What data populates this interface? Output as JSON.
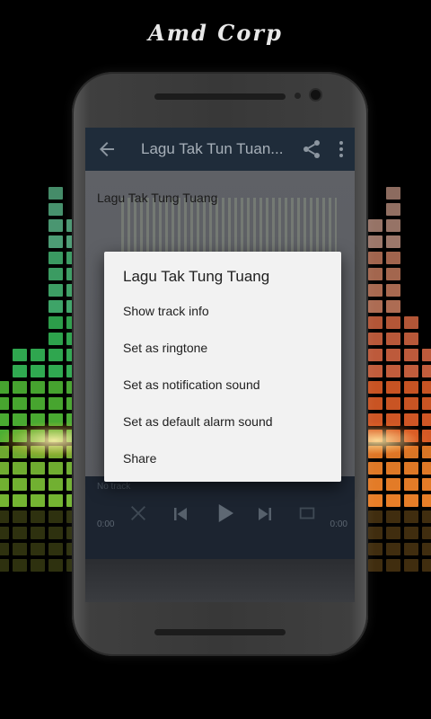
{
  "brand": {
    "text": "Amd Corp"
  },
  "app": {
    "title": "Lagu Tak Tun Tuan...",
    "song_label": "Lagu Tak Tung Tuang",
    "player": {
      "status": "No track",
      "time_left": "0:00",
      "time_right": "0:00"
    }
  },
  "dialog": {
    "title": "Lagu Tak Tung Tuang",
    "items": [
      {
        "label": "Show track info"
      },
      {
        "label": "Set as ringtone"
      },
      {
        "label": "Set as notification sound"
      },
      {
        "label": "Set as default alarm sound"
      },
      {
        "label": "Share"
      }
    ]
  },
  "colors": {
    "appbar": "#1f2c3a",
    "dialog_bg": "#f2f2f2",
    "eq_left": [
      "#7dffc0",
      "#5cf29a",
      "#3fe06a",
      "#5ad13c",
      "#7fc637",
      "#b7c53a"
    ],
    "eq_right": [
      "#ffc3ad",
      "#ff9f7a",
      "#ff7a4f",
      "#ff6a2d",
      "#ff8a2c",
      "#ffb23a"
    ]
  },
  "icons": {
    "back": "arrow-left-icon",
    "share": "share-icon",
    "more": "more-vert-icon",
    "shuffle": "shuffle-icon",
    "previous": "skip-previous-icon",
    "play": "play-icon",
    "next": "skip-next-icon",
    "repeat": "repeat-icon"
  }
}
